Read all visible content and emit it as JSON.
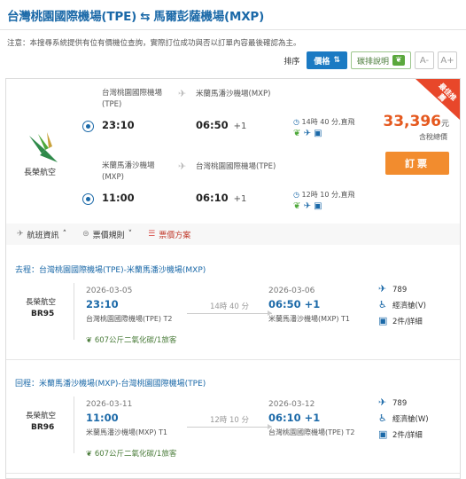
{
  "header": {
    "origin": "台灣桃園國際機場(TPE)",
    "arrow": "⇆",
    "destination": "馬爾彭薩機場(MXP)"
  },
  "notice": "注意：本搜尋系統提供有位有價機位查詢，實際訂位成功與否以訂單內容最後確認為主。",
  "sortbar": {
    "label": "排序",
    "price_button": "價格",
    "green_button": "碳排說明",
    "font_small": "A-",
    "font_large": "A+"
  },
  "summary": {
    "airline": "長榮航空",
    "outbound": {
      "from": "台灣桃園國際機場",
      "from_code": "(TPE)",
      "to": "米蘭馬潘沙機場(MXP)",
      "depart": "23:10",
      "arrive": "06:50",
      "plus": "+1",
      "duration": "14時 40 分,直飛"
    },
    "inbound": {
      "from": "米蘭馬潘沙機場",
      "from_code": "(MXP)",
      "to": "台灣桃園國際機場(TPE)",
      "depart": "11:00",
      "arrive": "06:10",
      "plus": "+1",
      "duration": "12時 10 分,直飛"
    },
    "ribbon": "最佳推薦",
    "price": "33,396",
    "currency": "元",
    "tax_note": "含稅總價",
    "book": "訂票"
  },
  "tabs": {
    "flight_info": "航班資訊",
    "fare_rules": "票價規則",
    "fare_plan": "票價方案"
  },
  "outbound_detail": {
    "heading": "去程：台灣桃園國際機場(TPE)-米蘭馬潘沙機場(MXP)",
    "airline": "長榮航空",
    "flight": "BR95",
    "dep_date": "2026-03-05",
    "dep_time": "23:10",
    "dep_airport": "台灣桃園國際機場(TPE) T2",
    "duration": "14時 40 分",
    "arr_date": "2026-03-06",
    "arr_time": "06:50 +1",
    "arr_airport": "米蘭馬潘沙機場(MXP) T1",
    "carbon": "607公斤二氧化碳/1旅客",
    "aircraft": "789",
    "cabin": "經濟艙(V)",
    "baggage": "2件/詳細"
  },
  "inbound_detail": {
    "heading": "回程：米蘭馬潘沙機場(MXP)-台灣桃園國際機場(TPE)",
    "airline": "長榮航空",
    "flight": "BR96",
    "dep_date": "2026-03-11",
    "dep_time": "11:00",
    "dep_airport": "米蘭馬潘沙機場(MXP) T1",
    "duration": "12時 10 分",
    "arr_date": "2026-03-12",
    "arr_time": "06:10 +1",
    "arr_airport": "台灣桃園國際機場(TPE) T2",
    "carbon": "607公斤二氧化碳/1旅客",
    "aircraft": "789",
    "cabin": "經濟艙(W)",
    "baggage": "2件/詳細"
  },
  "colors": {
    "brand_blue": "#1b69a8",
    "price_orange": "#e5591f",
    "book_orange": "#f28c2e",
    "ribbon_red": "#e8472a",
    "eco_green": "#4ea83a"
  }
}
